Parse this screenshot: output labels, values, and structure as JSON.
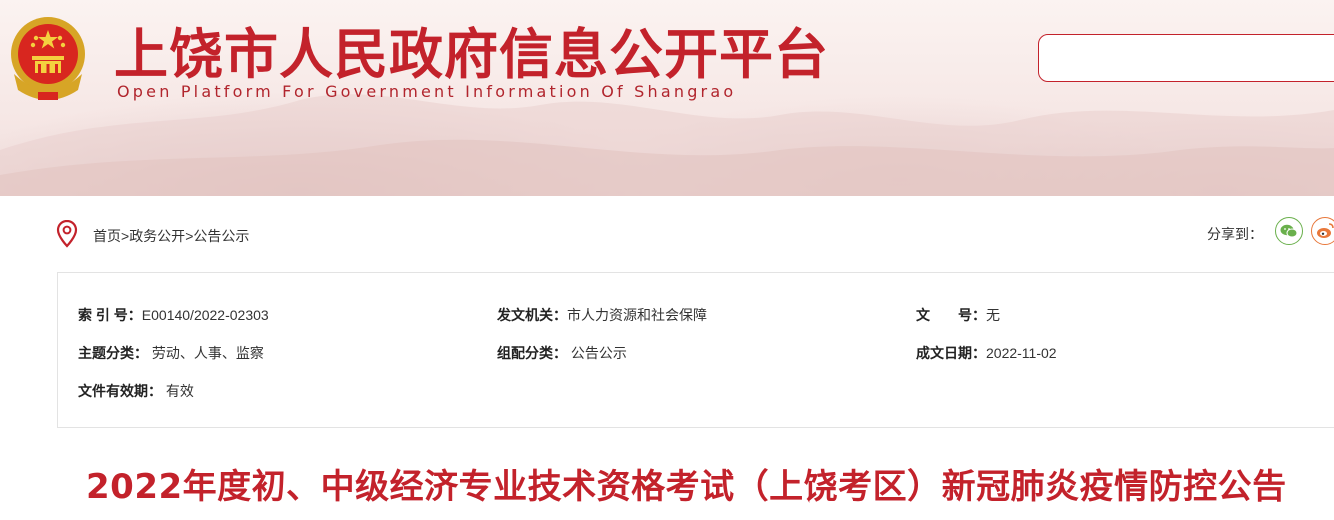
{
  "header": {
    "title": "上饶市人民政府信息公开平台",
    "subtitle": "Open Platform For Government Information Of Shangrao",
    "emblem_icon": "national-emblem-icon",
    "search": {
      "placeholder": ""
    }
  },
  "breadcrumb": {
    "icon": "location-pin-icon",
    "items": [
      "首页",
      "政务公开",
      "公告公示"
    ],
    "separator": ">"
  },
  "share": {
    "label": "分享到：",
    "targets": [
      "wechat-icon",
      "weibo-icon"
    ]
  },
  "meta": {
    "index_no_label": "索 引 号：",
    "index_no": "E00140/2022-02303",
    "issuer_label": "发文机关：",
    "issuer": "市人力资源和社会保障",
    "doc_no_label": "文　　号：",
    "doc_no": "无",
    "topic_label": "主题分类：",
    "topic": " 劳动、人事、监察",
    "category_label": "组配分类：",
    "category": " 公告公示",
    "date_label": "成文日期：",
    "date": "2022-11-02",
    "validity_label": "文件有效期：",
    "validity": " 有效"
  },
  "article": {
    "title": "2022年度初、中级经济专业技术资格考试（上饶考区）新冠肺炎疫情防控公告"
  },
  "colors": {
    "brand_red": "#c3222b",
    "wechat_green": "#6ab04c",
    "weibo_orange": "#e8773a"
  }
}
